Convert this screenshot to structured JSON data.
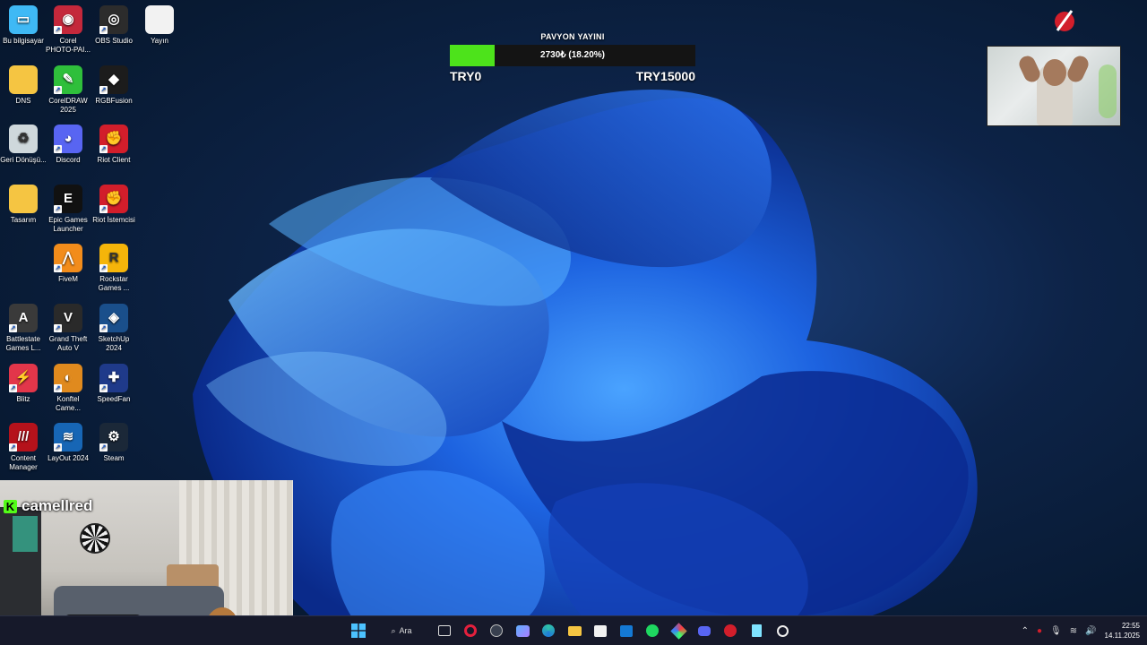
{
  "desktop_icons": [
    {
      "label": "Bu bilgisayar",
      "icon": "monitor-icon",
      "color": "#3fb9f5"
    },
    {
      "label": "Corel PHOTO-PAI...",
      "icon": "corel-photopaint-icon",
      "color": "#c4283b"
    },
    {
      "label": "OBS Studio",
      "icon": "obs-icon",
      "color": "#2c2c2c"
    },
    {
      "label": "Yayın",
      "icon": "document-icon",
      "color": "#f2f2f2"
    },
    {
      "label": "DNS",
      "icon": "folder-icon",
      "color": "#f5c542"
    },
    {
      "label": "CorelDRAW 2025",
      "icon": "coreldraw-icon",
      "color": "#2fbf3b"
    },
    {
      "label": "RGBFusion",
      "icon": "rgbfusion-icon",
      "color": "#1c1c1c"
    },
    {
      "label": "Geri Dönüşü...",
      "icon": "recycle-bin-icon",
      "color": "#cfd8dc"
    },
    {
      "label": "Discord",
      "icon": "discord-icon",
      "color": "#5865f2"
    },
    {
      "label": "Riot Client",
      "icon": "riot-icon",
      "color": "#d21e2b"
    },
    {
      "label": "Tasarım",
      "icon": "folder-icon",
      "color": "#f5c542"
    },
    {
      "label": "Epic Games Launcher",
      "icon": "epic-games-icon",
      "color": "#111111"
    },
    {
      "label": "Riot İstemcisi",
      "icon": "riot-icon",
      "color": "#d21e2b"
    },
    {
      "label": "FiveM",
      "icon": "fivem-icon",
      "color": "#f28c1b"
    },
    {
      "label": "Rockstar Games ...",
      "icon": "rockstar-icon",
      "color": "#f5b50a"
    },
    {
      "label": "Battlestate Games L...",
      "icon": "battlestate-icon",
      "color": "#3a3a3a"
    },
    {
      "label": "Grand Theft Auto V",
      "icon": "gta-icon",
      "color": "#2a2a2a"
    },
    {
      "label": "SketchUp 2024",
      "icon": "sketchup-icon",
      "color": "#1a4f8b"
    },
    {
      "label": "Blitz",
      "icon": "blitz-icon",
      "color": "#e2364a"
    },
    {
      "label": "Konftel Came...",
      "icon": "konftel-icon",
      "color": "#e08a1e"
    },
    {
      "label": "SpeedFan",
      "icon": "speedfan-icon",
      "color": "#1f3a8a"
    },
    {
      "label": "Content Manager",
      "icon": "content-manager-icon",
      "color": "#b5121b"
    },
    {
      "label": "LayOut 2024",
      "icon": "layout-icon",
      "color": "#1766b5"
    },
    {
      "label": "Steam",
      "icon": "steam-icon",
      "color": "#1b2838"
    }
  ],
  "donation_goal": {
    "title": "PAVYON YAYINI",
    "progress_text": "2730₺ (18.20%)",
    "progress_fraction": 0.182,
    "min_label": "TRY0",
    "max_label": "TRY15000",
    "fill_color": "#4de31b"
  },
  "webcam": {
    "username": "camellred",
    "platform_badge": "K",
    "platform_color": "#53fc18"
  },
  "taskbar": {
    "search_label": "Ara",
    "icons": [
      "windows-start-icon",
      "search-icon",
      "task-view-icon",
      "opera-gx-icon",
      "obs-icon",
      "msn-weather-icon",
      "edge-icon",
      "file-explorer-icon",
      "store-icon",
      "outlook-icon",
      "spotify-icon",
      "rgbfusion-icon",
      "discord-icon",
      "riot-icon",
      "notepad-icon",
      "chatgpt-icon"
    ],
    "tray_icons": [
      "chevron-up-icon",
      "riot-icon",
      "microphone-icon",
      "wifi-icon",
      "volume-icon"
    ],
    "time": "22:55",
    "date": "14.11.2025"
  }
}
